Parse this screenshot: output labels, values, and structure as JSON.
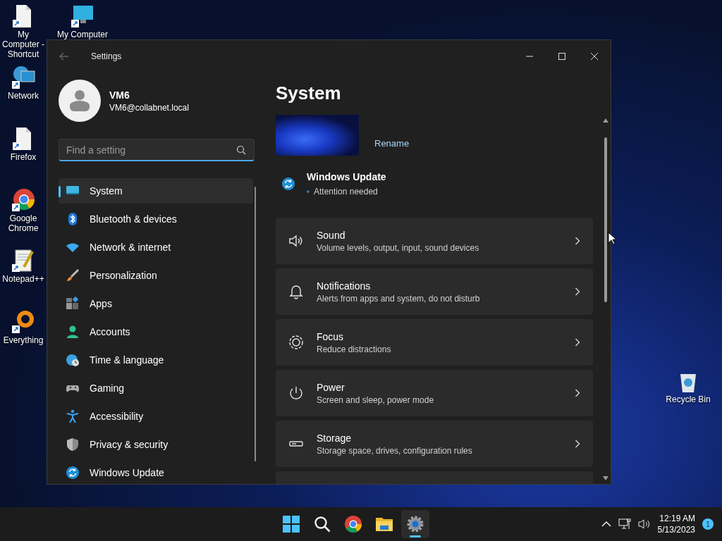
{
  "desktop": {
    "icons": [
      {
        "label": "My Computer - Shortcut",
        "kind": "document"
      },
      {
        "label": "My Computer",
        "kind": "monitor"
      },
      {
        "label": "Network",
        "kind": "network"
      },
      {
        "label": "Firefox",
        "kind": "document"
      },
      {
        "label": "Google Chrome",
        "kind": "chrome"
      },
      {
        "label": "Notepad++",
        "kind": "notepad"
      },
      {
        "label": "Everything",
        "kind": "everything"
      },
      {
        "label": "Recycle Bin",
        "kind": "recycle"
      }
    ]
  },
  "window": {
    "title": "Settings",
    "profile": {
      "name": "VM6",
      "email": "VM6@collabnet.local"
    },
    "search": {
      "placeholder": "Find a setting"
    },
    "nav": [
      {
        "label": "System",
        "kind": "system",
        "selected": true
      },
      {
        "label": "Bluetooth & devices",
        "kind": "bluetooth",
        "selected": false
      },
      {
        "label": "Network & internet",
        "kind": "wifi",
        "selected": false
      },
      {
        "label": "Personalization",
        "kind": "brush",
        "selected": false
      },
      {
        "label": "Apps",
        "kind": "apps",
        "selected": false
      },
      {
        "label": "Accounts",
        "kind": "person",
        "selected": false
      },
      {
        "label": "Time & language",
        "kind": "globe",
        "selected": false
      },
      {
        "label": "Gaming",
        "kind": "gamepad",
        "selected": false
      },
      {
        "label": "Accessibility",
        "kind": "accessibility",
        "selected": false
      },
      {
        "label": "Privacy & security",
        "kind": "shield",
        "selected": false
      },
      {
        "label": "Windows Update",
        "kind": "update",
        "selected": false
      }
    ],
    "page_title": "System",
    "rename": "Rename",
    "update": {
      "title": "Windows Update",
      "status": "Attention needed"
    },
    "cards": [
      {
        "kind": "sound",
        "title": "Sound",
        "subtitle": "Volume levels, output, input, sound devices"
      },
      {
        "kind": "bell",
        "title": "Notifications",
        "subtitle": "Alerts from apps and system, do not disturb"
      },
      {
        "kind": "focus",
        "title": "Focus",
        "subtitle": "Reduce distractions"
      },
      {
        "kind": "power",
        "title": "Power",
        "subtitle": "Screen and sleep, power mode"
      },
      {
        "kind": "storage",
        "title": "Storage",
        "subtitle": "Storage space, drives, configuration rules"
      }
    ]
  },
  "taskbar": {
    "apps": [
      {
        "kind": "start",
        "active": false
      },
      {
        "kind": "search",
        "active": false
      },
      {
        "kind": "chrome",
        "active": false
      },
      {
        "kind": "folder",
        "active": false
      },
      {
        "kind": "settings",
        "active": true
      }
    ],
    "clock": {
      "time": "12:19 AM",
      "date": "5/13/2023"
    },
    "notification_count": "1"
  }
}
